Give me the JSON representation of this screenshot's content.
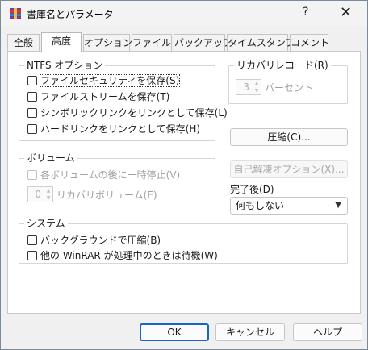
{
  "window": {
    "title": "書庫名とパラメータ",
    "help_label": "?",
    "close_label": "✕"
  },
  "tabs": [
    {
      "label": "全般"
    },
    {
      "label": "高度"
    },
    {
      "label": "オプション"
    },
    {
      "label": "ファイル"
    },
    {
      "label": "バックアップ"
    },
    {
      "label": "タイムスタンプ"
    },
    {
      "label": "コメント"
    }
  ],
  "ntfs": {
    "title": "NTFS オプション",
    "options": [
      {
        "label": "ファイルセキュリティを保存(S)",
        "checked": false
      },
      {
        "label": "ファイルストリームを保存(T)",
        "checked": false
      },
      {
        "label": "シンボリックリンクをリンクとして保存(L)",
        "checked": false
      },
      {
        "label": "ハードリンクをリンクとして保存(H)",
        "checked": false
      }
    ]
  },
  "recovery": {
    "title": "リカバリレコード(R)",
    "value": "3",
    "unit": "パーセント"
  },
  "compress_button": "圧縮(C)...",
  "volume": {
    "title": "ボリューム",
    "pause_label": "各ボリュームの後に一時停止(V)",
    "recovery_value": "0",
    "recovery_label": "リカバリボリューム(E)"
  },
  "sfx_button": "自己解凍オプション(X)...",
  "after_complete": {
    "label": "完了後(D)",
    "selected": "何もしない"
  },
  "system": {
    "title": "システム",
    "options": [
      {
        "label": "バックグラウンドで圧縮(B)",
        "checked": false
      },
      {
        "label": "他の WinRAR が処理中のときは待機(W)",
        "checked": false
      }
    ]
  },
  "footer": {
    "ok": "OK",
    "cancel": "キャンセル",
    "help": "ヘルプ"
  }
}
